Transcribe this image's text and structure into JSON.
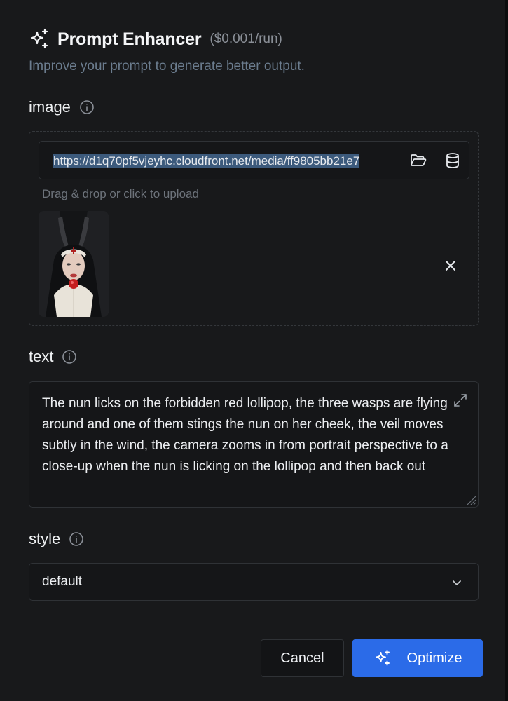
{
  "header": {
    "title": "Prompt Enhancer",
    "price": "($0.001/run)",
    "subtitle": "Improve your prompt to generate better output.",
    "icon": "sparkles-icon"
  },
  "image_field": {
    "label": "image",
    "url_value": "https://d1q70pf5vjeyhc.cloudfront.net/media/ff9805bb21e7",
    "hint": "Drag & drop or click to upload",
    "icons": [
      "folder-open-icon",
      "database-icon",
      "close-icon"
    ]
  },
  "text_field": {
    "label": "text",
    "value": "The nun licks on the forbidden red lollipop, the three wasps are flying around and one of them stings the nun on her cheek, the veil moves subtly in the wind, the camera zooms in from portrait perspective to a close-up when the nun is licking on the lollipop and then back out"
  },
  "style_field": {
    "label": "style",
    "selected": "default"
  },
  "actions": {
    "cancel_label": "Cancel",
    "optimize_label": "Optimize"
  },
  "colors": {
    "background": "#18191b",
    "accent": "#2b6be8",
    "subtitle": "#6b7c8e",
    "selection": "#3c5a7c"
  }
}
